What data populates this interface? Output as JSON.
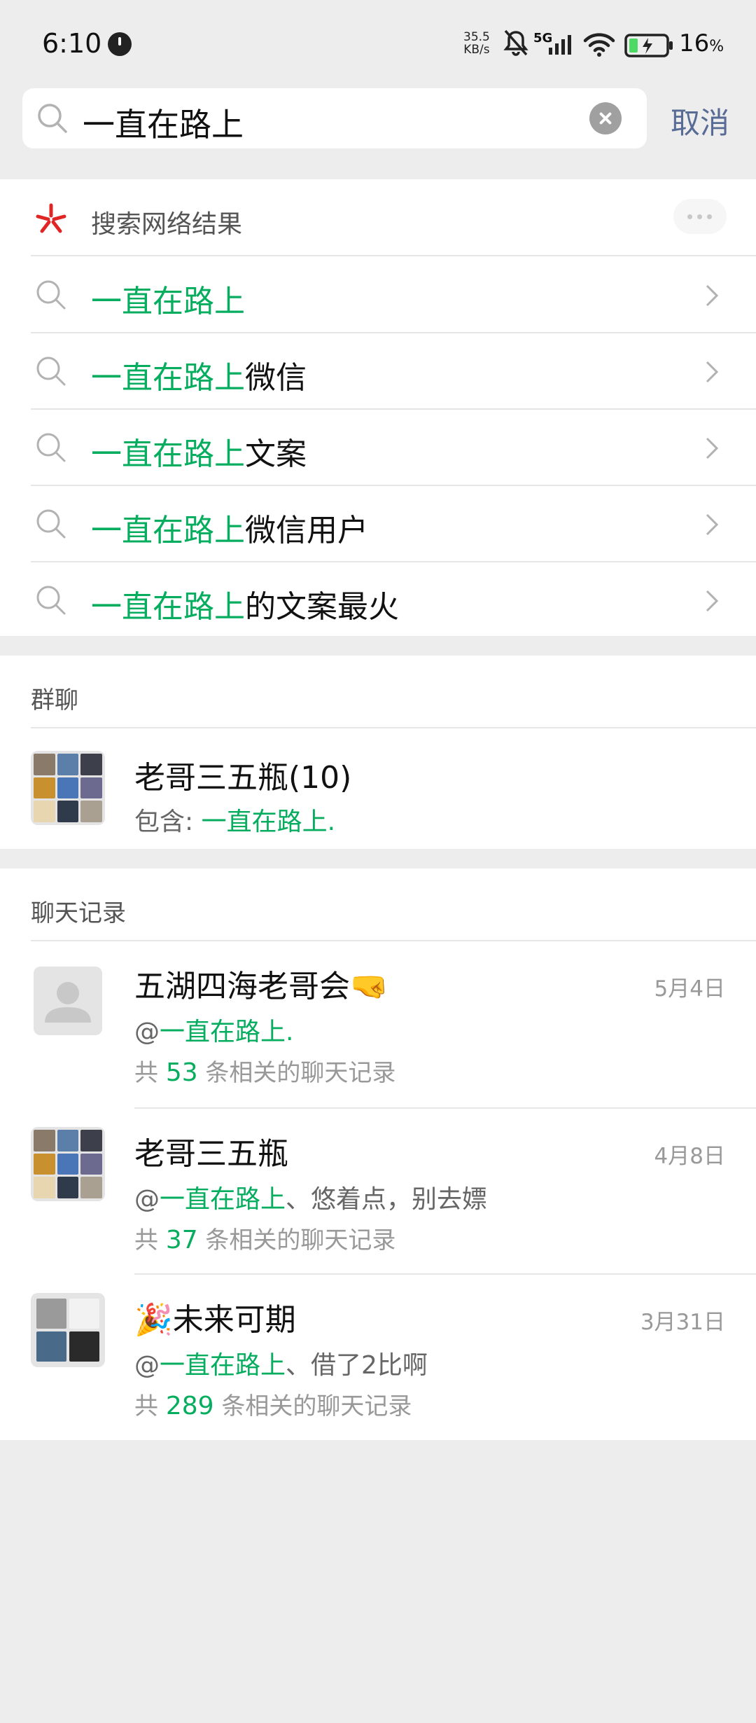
{
  "status_bar": {
    "time": "6:10",
    "net_speed_value": "35.5",
    "net_speed_unit": "KB/s",
    "network_type": "5G",
    "battery_percent": "16",
    "battery_symbol": "%"
  },
  "search": {
    "query": "一直在路上",
    "cancel_label": "取消"
  },
  "web_results": {
    "header": "搜索网络结果",
    "suggestions": [
      {
        "highlight": "一直在路上",
        "rest": ""
      },
      {
        "highlight": "一直在路上",
        "rest": "微信"
      },
      {
        "highlight": "一直在路上",
        "rest": "文案"
      },
      {
        "highlight": "一直在路上",
        "rest": "微信用户"
      },
      {
        "highlight": "一直在路上",
        "rest": "的文案最火"
      }
    ]
  },
  "groups": {
    "section_title": "群聊",
    "items": [
      {
        "name": "老哥三五瓶(10)",
        "sub_prefix": "包含: ",
        "sub_highlight": "一直在路上."
      }
    ]
  },
  "chats": {
    "section_title": "聊天记录",
    "items": [
      {
        "name": "五湖四海老哥会🤜",
        "date": "5月4日",
        "at": "@",
        "highlight": "一直在路上.",
        "rest": "",
        "count_prefix": "共 ",
        "count": "53",
        "count_suffix": " 条相关的聊天记录"
      },
      {
        "name": "老哥三五瓶",
        "date": "4月8日",
        "at": "@",
        "highlight": "一直在路上",
        "rest": "、悠着点，别去嫖",
        "count_prefix": "共 ",
        "count": "37",
        "count_suffix": " 条相关的聊天记录"
      },
      {
        "name": "🎉未来可期",
        "date": "3月31日",
        "at": "@",
        "highlight": "一直在路上",
        "rest": "、借了2比啊",
        "count_prefix": "共 ",
        "count": "289",
        "count_suffix": " 条相关的聊天记录"
      }
    ]
  },
  "colors": {
    "highlight": "#07ad5f",
    "link": "#576b95",
    "background": "#ededed"
  }
}
